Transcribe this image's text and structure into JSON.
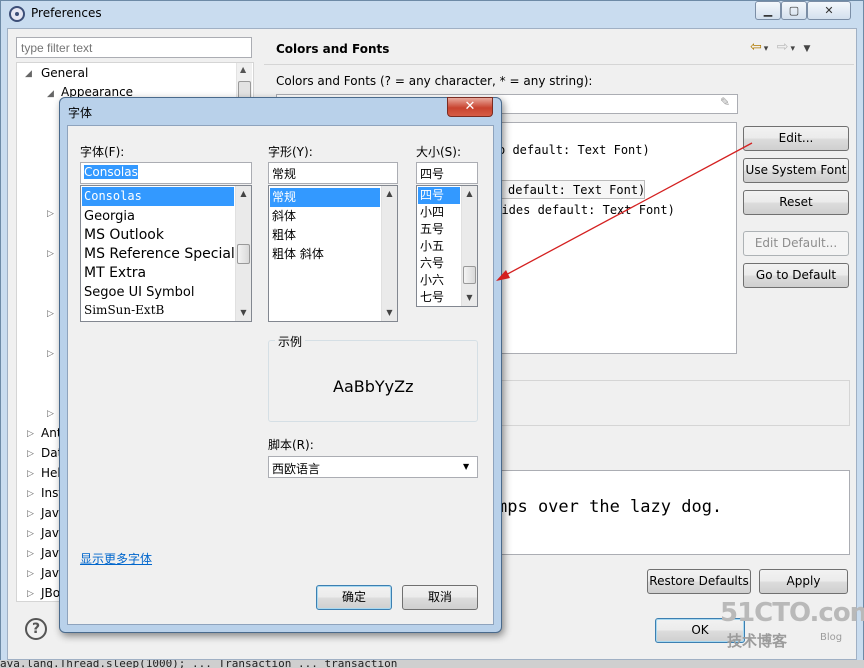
{
  "preferences": {
    "title": "Preferences",
    "filter_placeholder": "type filter text",
    "tree": {
      "general": "General",
      "appearance": "Appearance",
      "collapsed_items": [
        "Ant",
        "Dat",
        "Hel",
        "Inst",
        "Jav",
        "Jav",
        "Jav",
        "Jav",
        "JBo"
      ]
    },
    "panel_title": "Colors and Fonts",
    "panel_subtitle": "Colors and Fonts (? = any character, * = any string):",
    "font_list_lines": [
      "o default: Text Font)",
      "default: Text Font)",
      "rrides default: Text Font)"
    ],
    "preview_text": "mps over the lazy dog.",
    "buttons": {
      "edit": "Edit...",
      "use_system_font": "Use System Font",
      "reset": "Reset",
      "edit_default": "Edit Default...",
      "go_to_default": "Go to Default",
      "restore_defaults": "Restore Defaults",
      "apply": "Apply",
      "ok": "OK"
    },
    "help": "?",
    "bottom_strip_text": "ava.lang.Thread.sleep(1000); ... Transaction ... transaction"
  },
  "font_dialog": {
    "title": "字体",
    "close": "✕",
    "font_label": "字体(F):",
    "style_label": "字形(Y):",
    "size_label": "大小(S):",
    "font_value": "Consolas",
    "style_value": "常规",
    "size_value": "四号",
    "fonts": [
      "Consolas",
      "Georgia",
      "MS Outlook",
      "MS Reference Specialt",
      "MT Extra",
      "Segoe UI Symbol",
      "SimSun-ExtB"
    ],
    "styles": [
      "常规",
      "斜体",
      "粗体",
      "粗体 斜体"
    ],
    "sizes": [
      "四号",
      "小四",
      "五号",
      "小五",
      "六号",
      "小六",
      "七号"
    ],
    "sample_label": "示例",
    "sample_text": "AaBbYyZz",
    "script_label": "脚本(R):",
    "script_value": "西欧语言",
    "more_fonts": "显示更多字体",
    "ok": "确定",
    "cancel": "取消"
  },
  "watermark": {
    "logo": "51CTO.com",
    "sub": "技术博客",
    "blog": "Blog"
  },
  "colors": {
    "selection": "#3399ff",
    "arrow": "#d42020",
    "link": "#0066cc"
  }
}
